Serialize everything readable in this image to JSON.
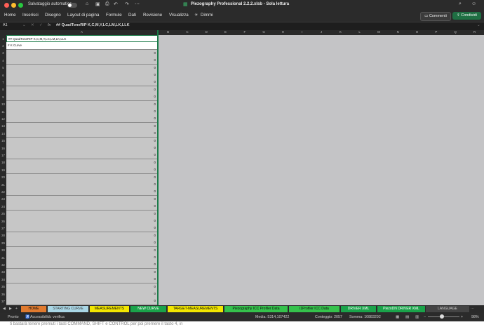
{
  "titlebar": {
    "autosave_label": "Salvataggio automatico",
    "doc_title": "Piezography Professional 2.2.2.xlsb  -  Sola lettura",
    "traffic_colors": [
      "#ff5f57",
      "#febc2e",
      "#28c840"
    ]
  },
  "ribbon": {
    "tabs": [
      "Home",
      "Inserisci",
      "Disegno",
      "Layout di pagina",
      "Formule",
      "Dati",
      "Revisione",
      "Visualizza",
      "Dimmi"
    ],
    "comments_label": "Commenti",
    "share_label": "Condividi"
  },
  "formula_bar": {
    "cell_ref": "A1",
    "fx": "fx",
    "content": "## QuadToneRIP K,C,M,Y,LC,LM,LK,LLK"
  },
  "columns": [
    "A",
    "B",
    "C",
    "D",
    "E",
    "F",
    "G",
    "H",
    "I",
    "J",
    "K",
    "L",
    "M",
    "N",
    "O",
    "P",
    "Q",
    "R"
  ],
  "cells": {
    "row1": "## QuadToneRIP K,C,M,Y,LC,LM,LK,LLK",
    "row2": "# K Curve",
    "zero": "0"
  },
  "rows": [
    "1",
    "2",
    "3",
    "4",
    "5",
    "6",
    "7",
    "8",
    "9",
    "10",
    "11",
    "12",
    "13",
    "14",
    "15",
    "16",
    "17",
    "18",
    "19",
    "20",
    "21",
    "22",
    "23",
    "24",
    "25",
    "26",
    "27",
    "28",
    "29",
    "30",
    "31",
    "32",
    "33",
    "34",
    "35",
    "36",
    "37"
  ],
  "sheet_tabs": [
    {
      "label": "HOME",
      "bg": "#e07a2e",
      "fg": "#111"
    },
    {
      "label": "STARTING CURVE",
      "bg": "#a9d7e6",
      "fg": "#444"
    },
    {
      "label": "MEASUREMENTS",
      "bg": "#f2e600",
      "fg": "#111"
    },
    {
      "label": "NEW CURVE",
      "bg": "#1aa34a",
      "fg": "#fff"
    },
    {
      "label": "TARGET-MEASUREMENTS",
      "bg": "#f2e600",
      "fg": "#111"
    },
    {
      "label": "Piezography ICC Profiler Data",
      "bg": "#35c24c",
      "fg": "#111"
    },
    {
      "label": "i1Profiler ICC Data",
      "bg": "#35c24c",
      "fg": "#111"
    },
    {
      "label": "DRIVER XML",
      "bg": "#1aa34a",
      "fg": "#fff"
    },
    {
      "label": "PiezoDN DRIVER XML",
      "bg": "#1aa34a",
      "fg": "#fff"
    },
    {
      "label": "LANGUAGE",
      "bg": "#444444",
      "fg": "#ccc"
    }
  ],
  "status": {
    "ready": "Pronto",
    "accessibility": "Accessibilità: verifica",
    "media": "Media: 5314,107422",
    "count": "Conteggio: 2057",
    "sum": "Somma: 10883292",
    "zoom": "98%"
  },
  "below_text": "ti bastarà tenere premuti i tasti COMMAND, SHIFT e CONTROL per poi premere il tasto 4, in"
}
